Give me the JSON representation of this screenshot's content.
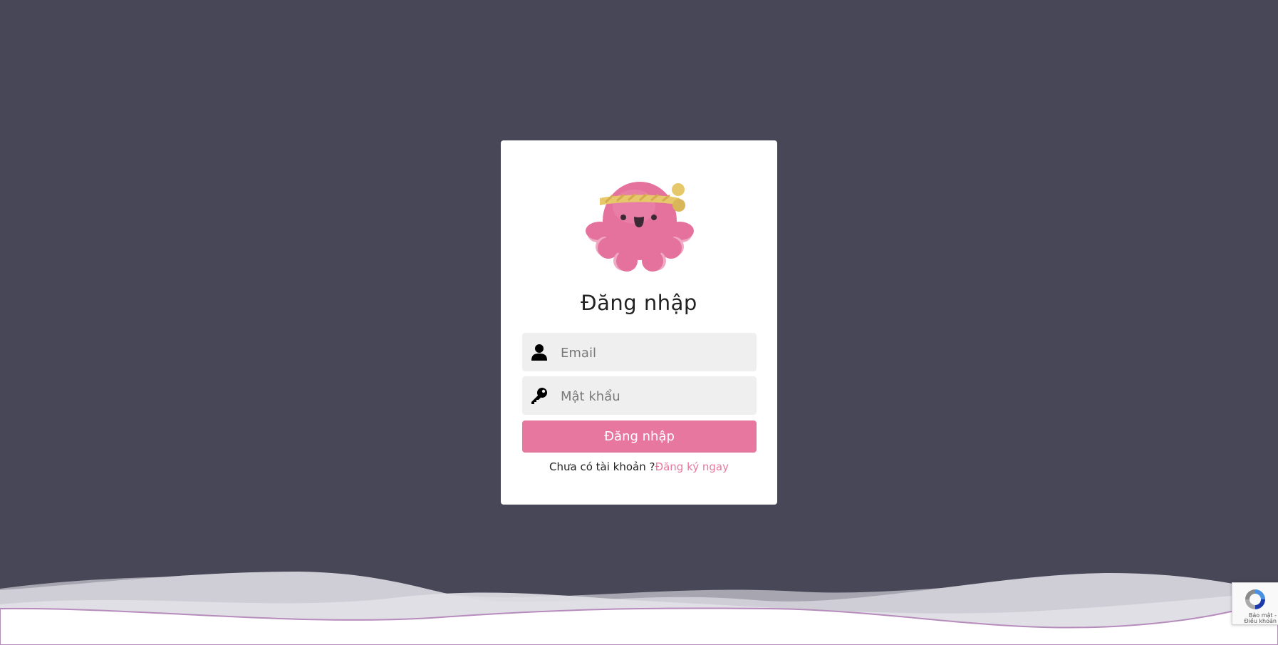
{
  "login": {
    "title": "Đăng nhập",
    "email_placeholder": "Email",
    "password_placeholder": "Mật khẩu",
    "submit_label": "Đăng nhập",
    "signup_prompt": "Chưa có tài khoản ?",
    "signup_link": "Đăng ký ngay"
  },
  "recaptcha": {
    "privacy_label": "Bảo mật",
    "separator": " - ",
    "terms_label": "Điều khoản"
  },
  "icons": {
    "logo": "octopus-headband-logo",
    "email": "user-icon",
    "password": "key-icon",
    "recaptcha": "recaptcha-icon"
  },
  "colors": {
    "background": "#484757",
    "card": "#ffffff",
    "accent": "#e8779f",
    "input_bg": "#efefef"
  }
}
